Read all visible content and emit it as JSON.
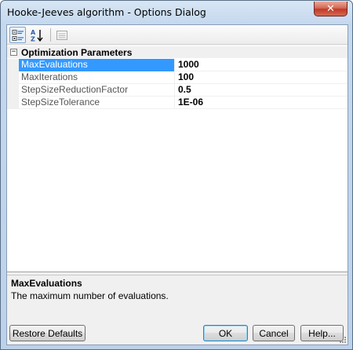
{
  "window": {
    "title": "Hooke-Jeeves algorithm - Options Dialog",
    "close_glyph": "✕"
  },
  "toolbar": {
    "categorized_icon": "categorized-view-icon",
    "alphabetical_icon": "alphabetical-sort-icon",
    "property_pages_icon": "property-pages-icon"
  },
  "grid": {
    "category": {
      "expander": "−",
      "label": "Optimization Parameters"
    },
    "properties": [
      {
        "name": "MaxEvaluations",
        "value": "1000",
        "selected": true
      },
      {
        "name": "MaxIterations",
        "value": "100",
        "selected": false
      },
      {
        "name": "StepSizeReductionFactor",
        "value": "0.5",
        "selected": false
      },
      {
        "name": "StepSizeTolerance",
        "value": "1E-06",
        "selected": false
      }
    ]
  },
  "description": {
    "title": "MaxEvaluations",
    "text": "The maximum number of evaluations."
  },
  "buttons": {
    "restore_defaults": "Restore Defaults",
    "ok": "OK",
    "cancel": "Cancel",
    "help": "Help..."
  },
  "colors": {
    "selection": "#3399ff",
    "title_bar": "#c4d8ee",
    "close_button": "#c0392b"
  }
}
